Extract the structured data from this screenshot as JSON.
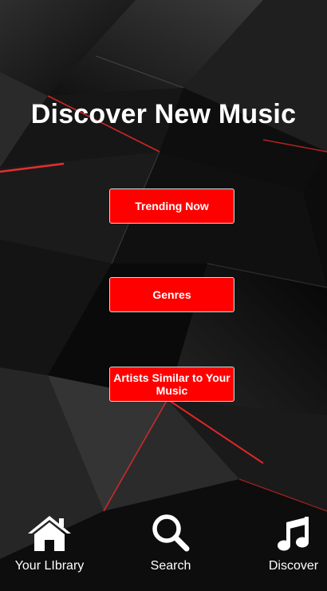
{
  "page": {
    "title": "Discover New Music"
  },
  "menu": {
    "trending_label": "Trending Now",
    "genres_label": "Genres",
    "similar_artists_label": "Artists Similar to Your Music"
  },
  "nav": {
    "items": [
      {
        "label": "Your LIbrary",
        "icon": "home-icon"
      },
      {
        "label": "Search",
        "icon": "search-icon"
      },
      {
        "label": "Discover",
        "icon": "music-note-icon"
      }
    ]
  },
  "colors": {
    "accent": "#ff0000",
    "background": "#0c0c0c",
    "text": "#ffffff"
  }
}
